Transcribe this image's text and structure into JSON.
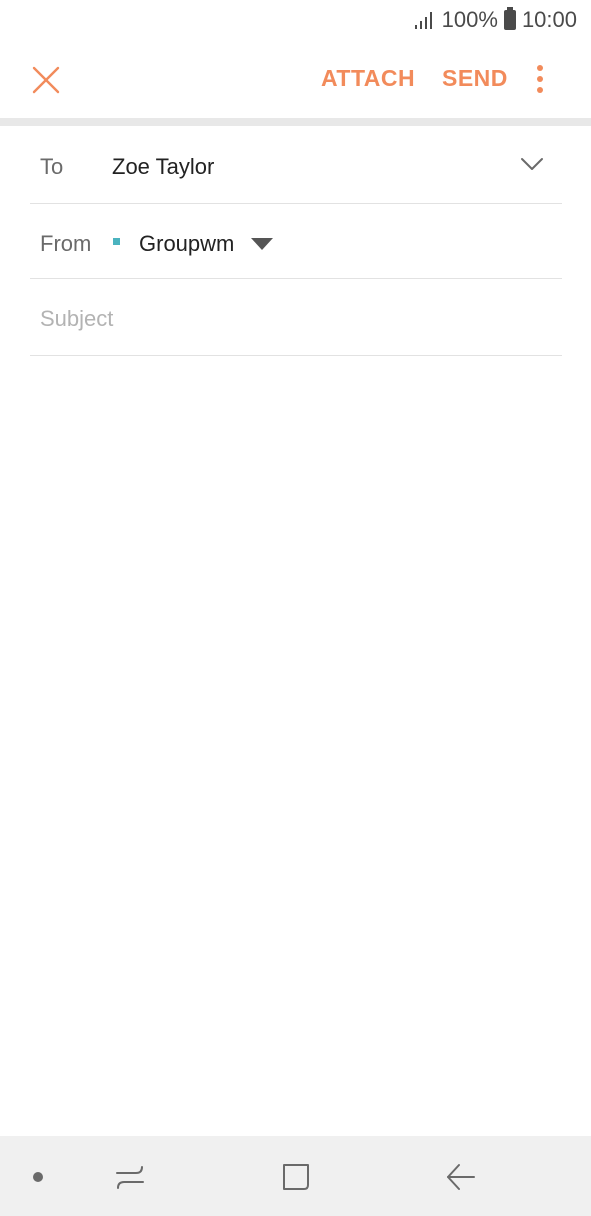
{
  "status_bar": {
    "battery_percent": "100%",
    "time": "10:00",
    "icons": [
      "signal-icon",
      "battery-icon"
    ]
  },
  "toolbar": {
    "close_icon": "close-icon",
    "attach_label": "ATTACH",
    "send_label": "SEND",
    "more_icon": "more-vertical-icon",
    "accent_color": "#f28b5b"
  },
  "compose": {
    "to_label": "To",
    "to_value": "Zoe Taylor",
    "from_label": "From",
    "from_value": "Groupwm",
    "from_account_color": "#4bb3bf",
    "subject_placeholder": "Subject",
    "subject_value": ""
  },
  "navbar": {
    "icons": [
      "dot-icon",
      "recent-apps-icon",
      "home-icon",
      "back-icon"
    ]
  }
}
